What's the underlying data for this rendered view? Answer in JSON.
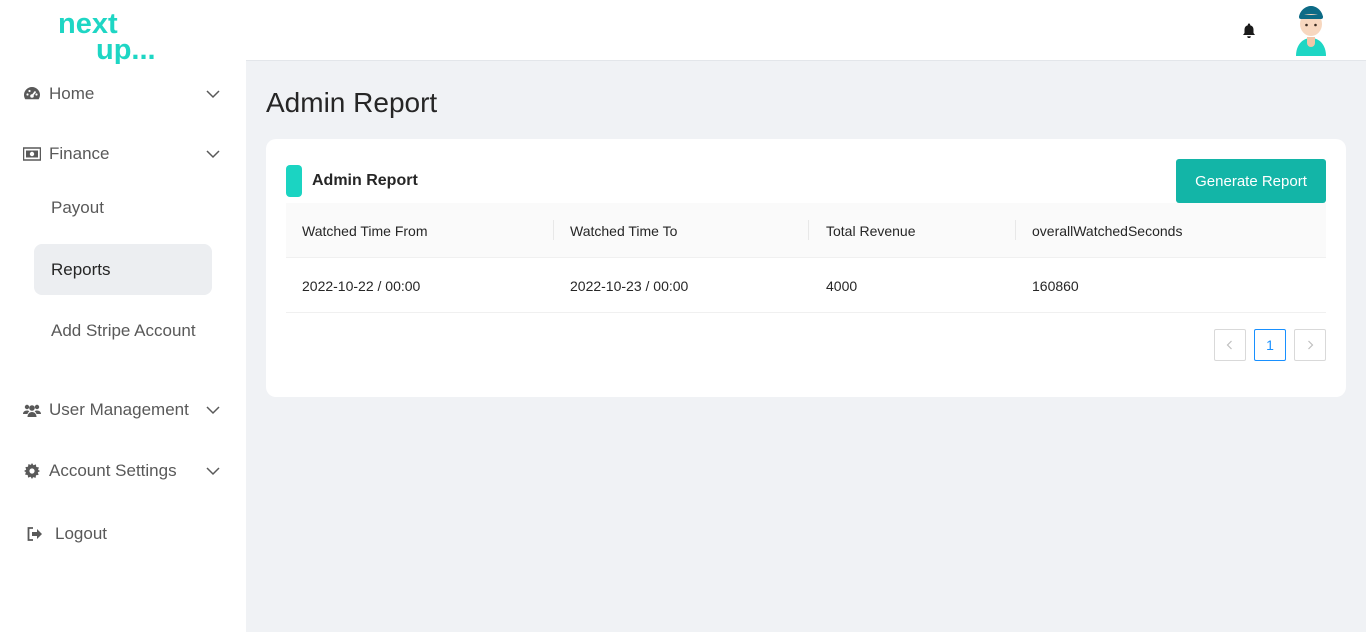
{
  "brand": {
    "logo_line1": "next",
    "logo_line2": "up..."
  },
  "sidebar": {
    "items": [
      {
        "label": "Home",
        "icon": "dashboard-icon"
      },
      {
        "label": "Finance",
        "icon": "money-bill-icon"
      },
      {
        "label": "User Management",
        "icon": "users-icon"
      },
      {
        "label": "Account Settings",
        "icon": "gear-icon"
      },
      {
        "label": "Logout",
        "icon": "sign-out-icon"
      }
    ],
    "finance_sub": [
      {
        "label": "Payout"
      },
      {
        "label": "Reports",
        "active": true
      },
      {
        "label": "Add Stripe Account"
      }
    ]
  },
  "header": {
    "bell_icon": "bell-icon",
    "avatar_icon": "avatar-icon"
  },
  "page": {
    "title": "Admin Report"
  },
  "card": {
    "title": "Admin Report",
    "generate_label": "Generate Report",
    "accent_color": "#13b5a7"
  },
  "table": {
    "columns": [
      "Watched Time From",
      "Watched Time To",
      "Total Revenue",
      "overallWatchedSeconds"
    ],
    "rows": [
      [
        "2022-10-22 / 00:00",
        "2022-10-23 / 00:00",
        "4000",
        "160860"
      ]
    ]
  },
  "pagination": {
    "current_page": "1"
  }
}
